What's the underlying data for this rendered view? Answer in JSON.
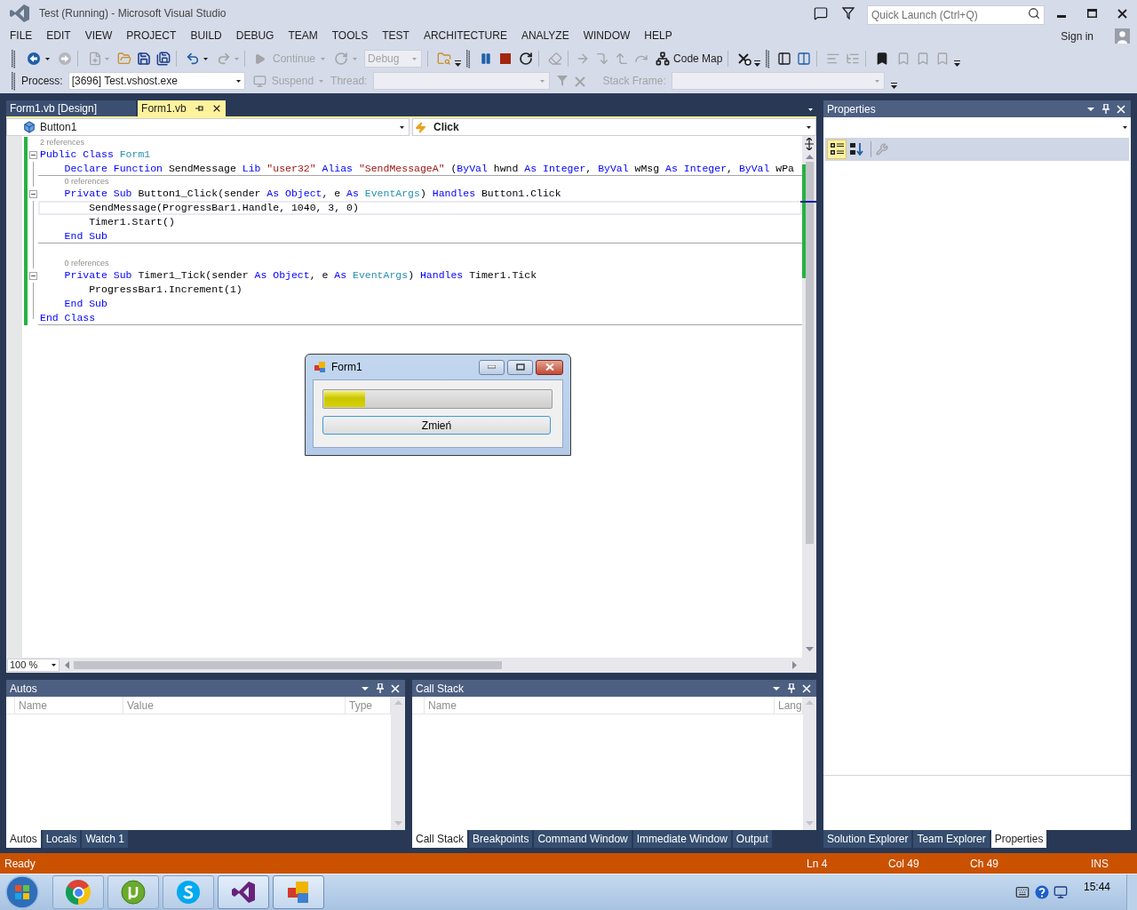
{
  "window": {
    "title": "Test (Running) - Microsoft Visual Studio"
  },
  "quick_launch": {
    "placeholder": "Quick Launch (Ctrl+Q)"
  },
  "menu": [
    "FILE",
    "EDIT",
    "VIEW",
    "PROJECT",
    "BUILD",
    "DEBUG",
    "TEAM",
    "TOOLS",
    "TEST",
    "ARCHITECTURE",
    "ANALYZE",
    "WINDOW",
    "HELP"
  ],
  "account": {
    "label": "Sign in"
  },
  "standard_toolbar": {
    "continue": {
      "label": "Continue",
      "disabled": true
    },
    "configuration": {
      "value": "Debug",
      "disabled": true
    },
    "code_map": {
      "label": "Code Map",
      "disabled": false
    }
  },
  "debug_location_toolbar": {
    "process": {
      "label": "Process:",
      "value": "[3696] Test.vshost.exe"
    },
    "suspend": {
      "label": "Suspend",
      "disabled": true
    },
    "thread": {
      "label": "Thread:",
      "disabled": true
    },
    "stack_frame": {
      "label": "Stack Frame:",
      "disabled": true
    }
  },
  "document_tabs": [
    {
      "label": "Form1.vb [Design]",
      "selected": false
    },
    {
      "label": "Form1.vb",
      "selected": true
    }
  ],
  "navigation_bar": {
    "type": "Button1",
    "member": "Click"
  },
  "code_lines": [
    {
      "kind": "code",
      "codelens": "2 references",
      "collapse": true,
      "separator_below": false,
      "caret_line": false,
      "tokens": [
        {
          "kind": "keyword",
          "text": "Public Class "
        },
        {
          "kind": "type",
          "text": "Form1"
        }
      ]
    },
    {
      "kind": "code",
      "collapse": false,
      "separator_below": true,
      "caret_line": false,
      "tokens": [
        {
          "kind": "keyword",
          "text": "    Declare Function"
        },
        {
          "kind": "plain",
          "text": " SendMessage "
        },
        {
          "kind": "keyword",
          "text": "Lib"
        },
        {
          "kind": "string",
          "text": " \"user32\""
        },
        {
          "kind": "keyword",
          "text": " Alias"
        },
        {
          "kind": "string",
          "text": " \"SendMessageA\""
        },
        {
          "kind": "plain",
          "text": " ("
        },
        {
          "kind": "keyword",
          "text": "ByVal"
        },
        {
          "kind": "plain",
          "text": " hwnd "
        },
        {
          "kind": "keyword",
          "text": "As Integer"
        },
        {
          "kind": "plain",
          "text": ", "
        },
        {
          "kind": "keyword",
          "text": "ByVal"
        },
        {
          "kind": "plain",
          "text": " wMsg "
        },
        {
          "kind": "keyword",
          "text": "As Integer"
        },
        {
          "kind": "plain",
          "text": ", "
        },
        {
          "kind": "keyword",
          "text": "ByVal"
        },
        {
          "kind": "plain",
          "text": " wPa"
        }
      ]
    },
    {
      "kind": "code",
      "codelens": "0 references",
      "collapse": true,
      "separator_below": false,
      "caret_line": false,
      "tokens": [
        {
          "kind": "keyword",
          "text": "    Private Sub"
        },
        {
          "kind": "plain",
          "text": " Button1_Click(sender "
        },
        {
          "kind": "keyword",
          "text": "As Object"
        },
        {
          "kind": "plain",
          "text": ", e "
        },
        {
          "kind": "keyword",
          "text": "As"
        },
        {
          "kind": "type",
          "text": " EventArgs"
        },
        {
          "kind": "plain",
          "text": ") "
        },
        {
          "kind": "keyword",
          "text": "Handles"
        },
        {
          "kind": "plain",
          "text": " Button1.Click"
        }
      ]
    },
    {
      "kind": "code",
      "collapse": false,
      "separator_below": false,
      "caret_line": true,
      "tokens": [
        {
          "kind": "plain",
          "text": "        SendMessage(ProgressBar1.Handle, 1040, 3, 0)"
        }
      ]
    },
    {
      "kind": "code",
      "collapse": false,
      "separator_below": false,
      "caret_line": false,
      "tokens": [
        {
          "kind": "plain",
          "text": "        Timer1.Start()"
        }
      ]
    },
    {
      "kind": "code",
      "collapse": false,
      "separator_below": true,
      "caret_line": false,
      "tokens": [
        {
          "kind": "keyword",
          "text": "    End Sub"
        }
      ]
    },
    {
      "kind": "blank"
    },
    {
      "kind": "code",
      "codelens": "0 references",
      "collapse": true,
      "separator_below": false,
      "caret_line": false,
      "tokens": [
        {
          "kind": "keyword",
          "text": "    Private Sub"
        },
        {
          "kind": "plain",
          "text": " Timer1_Tick(sender "
        },
        {
          "kind": "keyword",
          "text": "As Object"
        },
        {
          "kind": "plain",
          "text": ", e "
        },
        {
          "kind": "keyword",
          "text": "As"
        },
        {
          "kind": "type",
          "text": " EventArgs"
        },
        {
          "kind": "plain",
          "text": ") "
        },
        {
          "kind": "keyword",
          "text": "Handles"
        },
        {
          "kind": "plain",
          "text": " Timer1.Tick"
        }
      ]
    },
    {
      "kind": "code",
      "collapse": false,
      "separator_below": false,
      "caret_line": false,
      "tokens": [
        {
          "kind": "plain",
          "text": "        ProgressBar1.Increment(1)"
        }
      ]
    },
    {
      "kind": "code",
      "collapse": false,
      "separator_below": false,
      "caret_line": false,
      "tokens": [
        {
          "kind": "keyword",
          "text": "    End Sub"
        }
      ]
    },
    {
      "kind": "code",
      "collapse": false,
      "separator_below": true,
      "caret_line": false,
      "tokens": [
        {
          "kind": "keyword",
          "text": "End Class"
        }
      ]
    }
  ],
  "zoom": {
    "value": "100 %"
  },
  "running_form": {
    "title": "Form1",
    "progress": {
      "level": 0.18
    },
    "button": "Zmień"
  },
  "autos": {
    "title": "Autos",
    "columns": [
      "Name",
      "Value",
      "Type"
    ],
    "tabs": [
      {
        "label": "Autos",
        "selected": true
      },
      {
        "label": "Locals",
        "selected": false
      },
      {
        "label": "Watch 1",
        "selected": false
      }
    ]
  },
  "call_stack": {
    "title": "Call Stack",
    "columns": [
      "Name",
      "Lang"
    ],
    "tabs": [
      {
        "label": "Call Stack",
        "selected": true
      },
      {
        "label": "Breakpoints",
        "selected": false
      },
      {
        "label": "Command Window",
        "selected": false
      },
      {
        "label": "Immediate Window",
        "selected": false
      },
      {
        "label": "Output",
        "selected": false
      }
    ]
  },
  "properties": {
    "title": "Properties",
    "view_buttons": [
      {
        "selected": true
      },
      {
        "selected": false
      }
    ],
    "tabs": [
      {
        "label": "Solution Explorer",
        "selected": false
      },
      {
        "label": "Team Explorer",
        "selected": false
      },
      {
        "label": "Properties",
        "selected": true
      }
    ]
  },
  "status_bar": {
    "message": "Ready",
    "line": "Ln 4",
    "column": "Col 49",
    "char": "Ch 49",
    "mode": "INS"
  },
  "taskbar": {
    "time": "15:44"
  }
}
